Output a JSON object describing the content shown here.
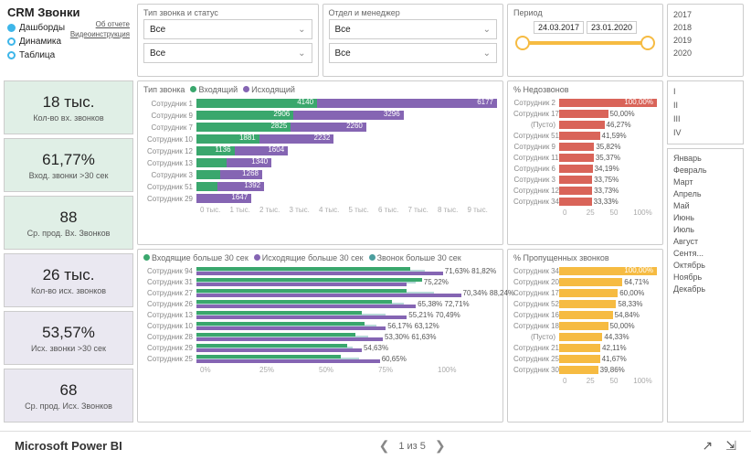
{
  "header": {
    "title_prefix": "CRM ",
    "title_bold": "Звонки",
    "nav": [
      "Дашборды",
      "Динамика",
      "Таблица"
    ],
    "nav_selected": 0,
    "link1": "Об отчете",
    "link2": "Видеоинструкция"
  },
  "filters": {
    "col1_label": "Тип звонка и статус",
    "col2_label": "Отдел и менеджер",
    "value": "Все"
  },
  "period": {
    "label": "Период",
    "from": "24.03.2017",
    "to": "23.01.2020"
  },
  "years": [
    "2017",
    "2018",
    "2019",
    "2020"
  ],
  "quarters": [
    "I",
    "II",
    "III",
    "IV"
  ],
  "months": [
    "Январь",
    "Февраль",
    "Март",
    "Апрель",
    "Май",
    "Июнь",
    "Июль",
    "Август",
    "Сентя...",
    "Октябрь",
    "Ноябрь",
    "Декабрь"
  ],
  "kpis": [
    {
      "val": "18 тыс.",
      "lbl": "Кол-во вх. звонков",
      "cls": "green"
    },
    {
      "val": "61,77%",
      "lbl": "Вход. звонки >30 сек",
      "cls": "green"
    },
    {
      "val": "88",
      "lbl": "Ср. прод. Вх. Звонков",
      "cls": "green"
    },
    {
      "val": "26 тыс.",
      "lbl": "Кол-во исх. звонков",
      "cls": "purple"
    },
    {
      "val": "53,57%",
      "lbl": "Исх. звонки >30 сек",
      "cls": "purple"
    },
    {
      "val": "68",
      "lbl": "Ср. прод. Исх. Звонков",
      "cls": "purple"
    }
  ],
  "chart_data": {
    "type_chart": {
      "type": "bar",
      "title": "Тип звонка",
      "legend": [
        "Входящий",
        "Исходящий"
      ],
      "max": 9000,
      "categories": [
        "Сотрудник 1",
        "Сотрудник 9",
        "Сотрудник 7",
        "Сотрудник 10",
        "Сотрудник 12",
        "Сотрудник 13",
        "Сотрудник 3",
        "Сотрудник 51",
        "Сотрудник 29"
      ],
      "series": [
        {
          "name": "Входящий",
          "values": [
            4140,
            2906,
            2825,
            1881,
            1136,
            905,
            701,
            636,
            0
          ]
        },
        {
          "name": "Исходящий",
          "values": [
            6177,
            3296,
            2260,
            2232,
            1604,
            1340,
            1268,
            1392,
            1647
          ]
        }
      ],
      "axis": [
        "0 тыс.",
        "1 тыс.",
        "2 тыс.",
        "3 тыс.",
        "4 тыс.",
        "5 тыс.",
        "6 тыс.",
        "7 тыс.",
        "8 тыс.",
        "9 тыс."
      ]
    },
    "thirty_chart": {
      "type": "bar",
      "legend": [
        "Входящие больше 30 сек",
        "Исходящие больше 30 сек",
        "Звонок больше 30 сек"
      ],
      "max": 100,
      "categories": [
        "Сотрудник 94",
        "Сотрудник 31",
        "Сотрудник 27",
        "Сотрудник 26",
        "Сотрудник 13",
        "Сотрудник 10",
        "Сотрудник 28",
        "Сотрудник 29",
        "Сотрудник 25"
      ],
      "labels": [
        [
          "71,63%",
          "81,82%"
        ],
        [
          "75,22%"
        ],
        [
          "70,34%",
          "88,24%"
        ],
        [
          "65,38%",
          "72,71%"
        ],
        [
          "55,21%",
          "70,49%"
        ],
        [
          "56,17%",
          "63,12%"
        ],
        [
          "53,30%",
          "61,63%"
        ],
        [
          "54,63%"
        ],
        [
          "60,65%"
        ]
      ],
      "axis": [
        "0%",
        "25%",
        "50%",
        "75%",
        "100%"
      ]
    },
    "missed_pct": {
      "type": "bar",
      "title": "% Недозвонов",
      "max": 100,
      "categories": [
        "Сотрудник 2",
        "Сотрудник 17",
        "(Пусто)",
        "Сотрудник 51",
        "Сотрудник 9",
        "Сотрудник 11",
        "Сотрудник 6",
        "Сотрудник 3",
        "Сотрудник 12",
        "Сотрудник 34"
      ],
      "values": [
        100.0,
        50.0,
        46.27,
        41.59,
        35.82,
        35.37,
        34.19,
        33.75,
        33.73,
        33.33
      ],
      "labels": [
        "100,00%",
        "50,00%",
        "46,27%",
        "41,59%",
        "35,82%",
        "35,37%",
        "34,19%",
        "33,75%",
        "33,73%",
        "33,33%"
      ],
      "axis": [
        "0",
        "25",
        "50",
        "100%"
      ]
    },
    "dropped_pct": {
      "type": "bar",
      "title": "% Пропущенных звонков",
      "max": 100,
      "categories": [
        "Сотрудник 34",
        "Сотрудник 20",
        "Сотрудник 17",
        "Сотрудник 52",
        "Сотрудник 16",
        "Сотрудник 18",
        "(Пусто)",
        "Сотрудник 21",
        "Сотрудник 25",
        "Сотрудник 30"
      ],
      "values": [
        100.0,
        64.71,
        60.0,
        58.33,
        54.84,
        50.0,
        44.33,
        42.11,
        41.67,
        39.86
      ],
      "labels": [
        "100,00%",
        "64,71%",
        "60,00%",
        "58,33%",
        "54,84%",
        "50,00%",
        "44,33%",
        "42,11%",
        "41,67%",
        "39,86%"
      ],
      "axis": [
        "0",
        "25",
        "50",
        "100%"
      ]
    }
  },
  "footer": {
    "brand": "Microsoft Power BI",
    "pager": "1 из 5"
  }
}
